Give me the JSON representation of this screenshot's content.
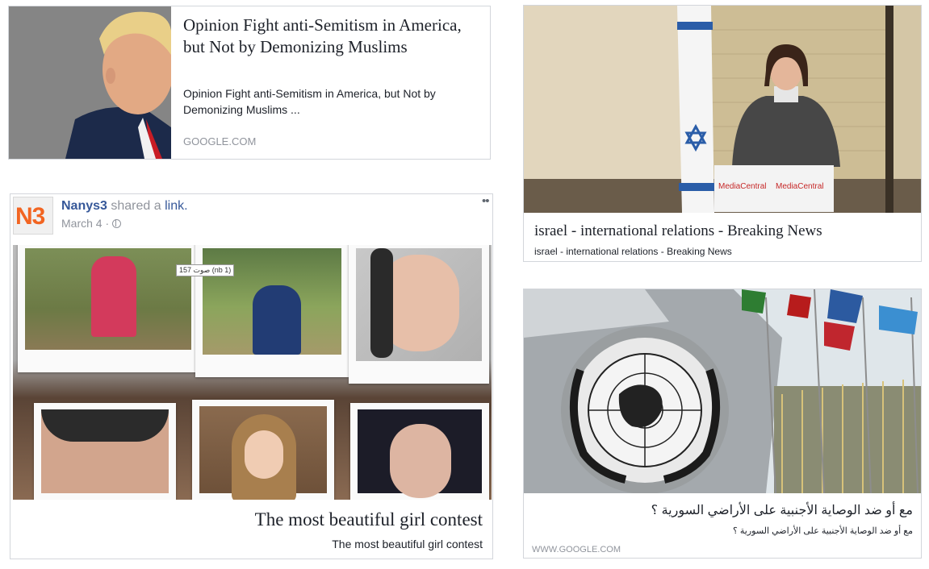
{
  "card1": {
    "title": "Opinion Fight anti-Semitism in America, but Not by Demonizing Muslims",
    "description": "Opinion Fight anti-Semitism in America, but Not by Demonizing Muslims ...",
    "domain": "GOOGLE.COM"
  },
  "card2": {
    "title": "israel - international relations - Breaking News",
    "description": "israel - international relations - Breaking News",
    "podium_sign_1": "MediaCentral",
    "podium_sign_2": "MediaCentral"
  },
  "card3": {
    "page_logo": "N3",
    "author": "Nanys3",
    "shared_text": " shared a ",
    "link_text": "link.",
    "date": "March 4 ·",
    "privacy_icon": "globe-icon",
    "more_icon": "ellipsis-icon",
    "photo_label": "صوت 157 (nb 1)",
    "title": "The most beautiful girl contest",
    "description": "The most beautiful girl contest"
  },
  "card4": {
    "title": "مع أو ضد الوصاية الأجنبية على الأراضي السورية ؟",
    "description": "مع أو ضد الوصاية الأجنبية على الأراضي السورية ؟",
    "domain": "WWW.GOOGLE.COM"
  },
  "colors": {
    "link_blue": "#365899",
    "muted_gray": "#90949c",
    "text_dark": "#1d2129",
    "border": "#d3d6db",
    "logo_orange": "#f26522"
  }
}
